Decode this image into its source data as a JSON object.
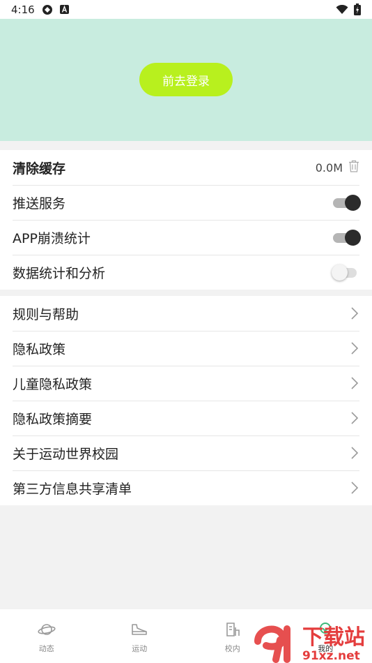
{
  "status_bar": {
    "time": "4:16",
    "icons": [
      "sync-icon",
      "a-badge-icon",
      "wifi-icon",
      "battery-icon"
    ]
  },
  "header": {
    "login_label": "前去登录",
    "colors": {
      "background": "#c8ecdf",
      "button": "#b8f01e"
    }
  },
  "settings": {
    "clear_cache": {
      "label": "清除缓存",
      "size": "0.0M"
    },
    "push_service": {
      "label": "推送服务",
      "enabled": true
    },
    "crash_stats": {
      "label": "APP崩溃统计",
      "enabled": true
    },
    "data_analysis": {
      "label": "数据统计和分析",
      "enabled": false
    }
  },
  "menu": {
    "items": [
      {
        "label": "规则与帮助"
      },
      {
        "label": "隐私政策"
      },
      {
        "label": "儿童隐私政策"
      },
      {
        "label": "隐私政策摘要"
      },
      {
        "label": "关于运动世界校园"
      },
      {
        "label": "第三方信息共享清单"
      }
    ]
  },
  "bottom_nav": {
    "items": [
      {
        "label": "动态",
        "icon": "planet-icon"
      },
      {
        "label": "运动",
        "icon": "shoe-icon"
      },
      {
        "label": "校内",
        "icon": "document-icon"
      },
      {
        "label": "我的",
        "icon": "profile-icon"
      }
    ]
  },
  "watermark": {
    "brand": "下载站",
    "site": "91xz.net"
  }
}
